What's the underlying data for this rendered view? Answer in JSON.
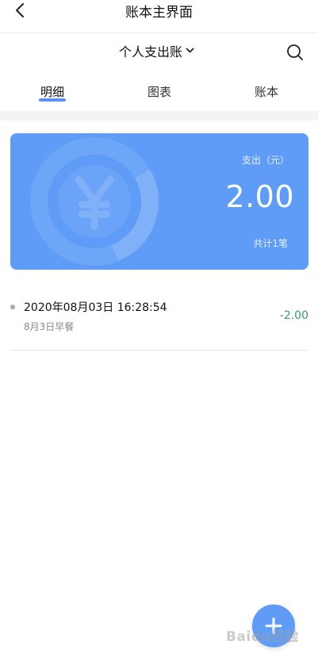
{
  "header": {
    "title": "账本主界面",
    "back_icon": "chevron-left-icon"
  },
  "book_selector": {
    "name": "个人支出账",
    "dropdown_icon": "chevron-down-icon",
    "search_icon": "search-icon"
  },
  "tabs": [
    {
      "label": "明细",
      "active": true
    },
    {
      "label": "图表",
      "active": false
    },
    {
      "label": "账本",
      "active": false
    }
  ],
  "summary_card": {
    "label": "支出（元）",
    "amount": "2.00",
    "count_text": "共计1笔",
    "background_color": "#5e9cf7",
    "emblem_icon": "yen-coin-icon"
  },
  "records": [
    {
      "datetime": "2020年08月03日 16:28:54",
      "note": "8月3日早餐",
      "amount": "-2.00",
      "amount_color": "#3a9a6a"
    }
  ],
  "fab": {
    "icon": "plus-icon"
  },
  "watermark": {
    "text": "Baidu经验"
  }
}
